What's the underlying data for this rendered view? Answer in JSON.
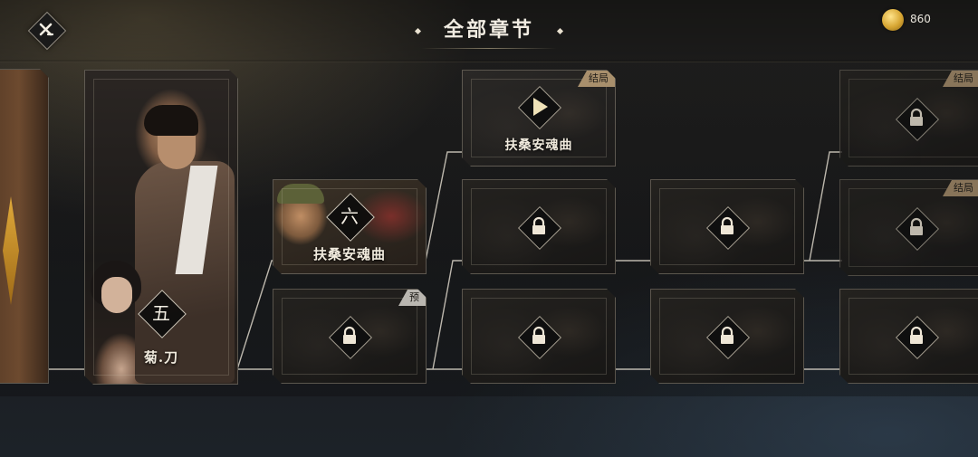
{
  "header": {
    "title": "全部章节",
    "coin_count": "860"
  },
  "colors": {
    "badge_final": "#a88f6c",
    "badge_preview": "#b9b6b0",
    "line": "#d9d3c7"
  },
  "chapters": {
    "ch5": {
      "number": "五",
      "name": "菊.刀"
    },
    "ch6": {
      "number": "六",
      "name": "扶桑安魂曲"
    },
    "ch6_preview": {
      "badge": "预"
    },
    "ending_1": {
      "name": "扶桑安魂曲",
      "badge": "结局"
    },
    "ending_2": {
      "badge": "结局"
    },
    "ending_3": {
      "badge": "结局"
    }
  },
  "icons": {
    "close": "close-icon",
    "coin": "coin-icon",
    "lock": "lock-icon",
    "play": "play-icon"
  }
}
